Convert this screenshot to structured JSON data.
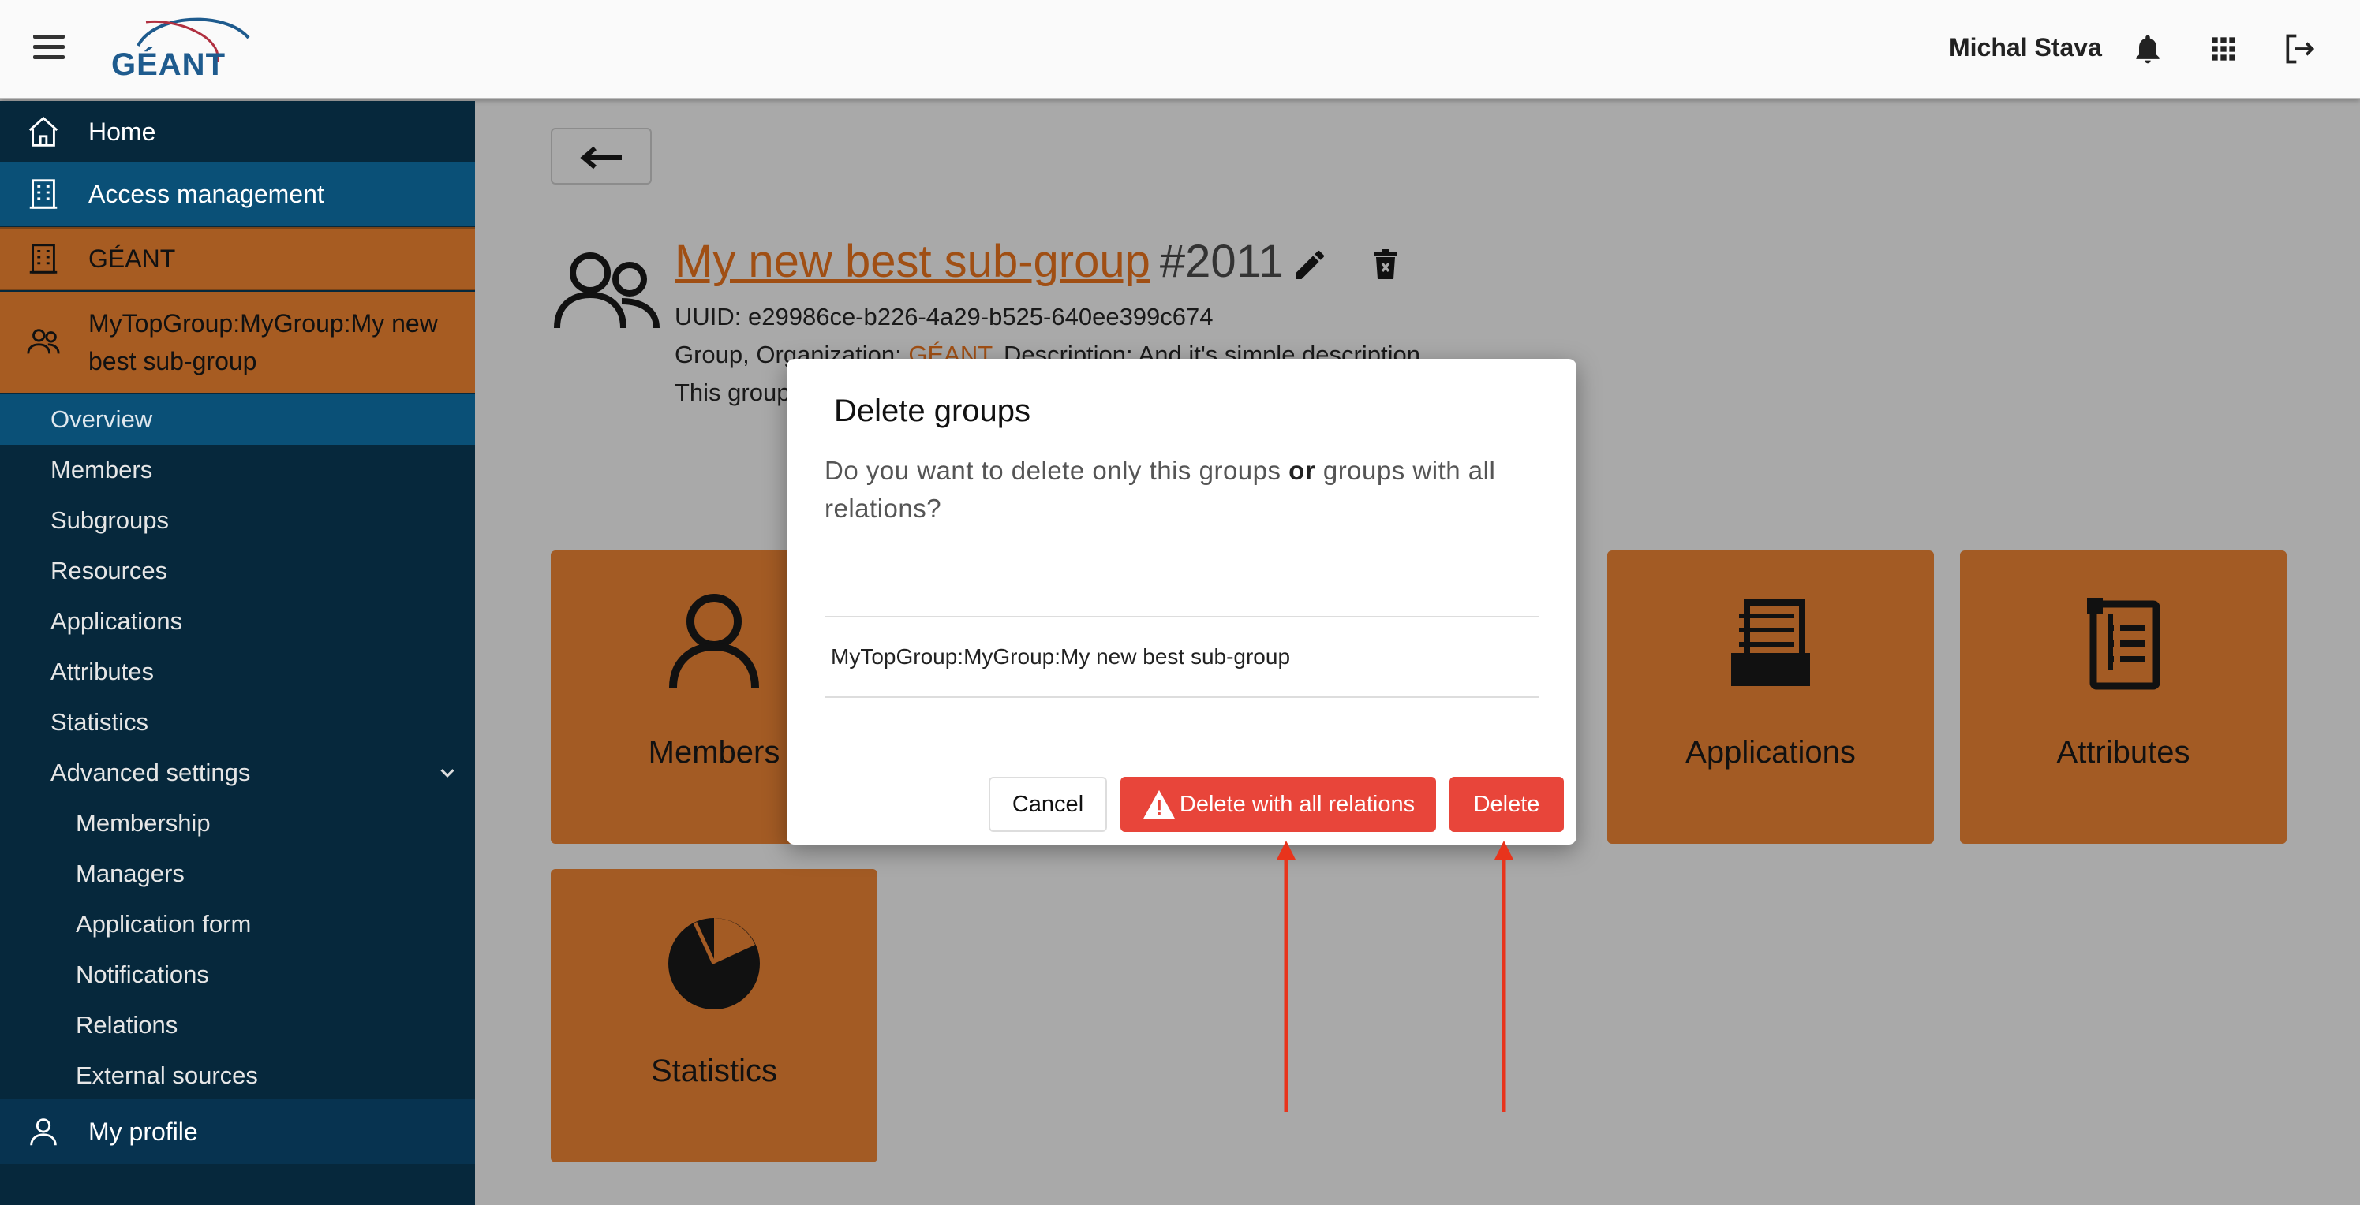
{
  "header": {
    "logo_text": "GÉANT",
    "user_name": "Michal Stava"
  },
  "sidebar": {
    "home": "Home",
    "access_management": "Access management",
    "organization": "GÉANT",
    "group": "MyTopGroup:MyGroup:My new best sub-group",
    "items": [
      "Overview",
      "Members",
      "Subgroups",
      "Resources",
      "Applications",
      "Attributes",
      "Statistics",
      "Advanced settings"
    ],
    "advanced_items": [
      "Membership",
      "Managers",
      "Application form",
      "Notifications",
      "Relations",
      "External sources"
    ],
    "my_profile": "My profile"
  },
  "group": {
    "name": "My new best sub-group",
    "id": "#2011",
    "uuid_line": "UUID: e29986ce-b226-4a29-b525-640ee399c674",
    "info_prefix": "Group, Organization: ",
    "info_org": "GÉANT",
    "info_suffix": ". Description: And it's simple description",
    "line3": "This group"
  },
  "tiles": [
    "Members",
    "Applications",
    "Attributes",
    "Statistics"
  ],
  "dialog": {
    "title": "Delete groups",
    "message_part1": "Do you want to delete only this groups ",
    "message_bold": "or",
    "message_part2": " groups with all relations?",
    "item": "MyTopGroup:MyGroup:My new best sub-group",
    "cancel": "Cancel",
    "delete_all": "Delete with all relations",
    "delete": "Delete"
  },
  "colors": {
    "accent_orange": "#a35b24",
    "sidebar_bg": "#06283c",
    "sidebar_active": "#0a5077",
    "danger": "#e8453a",
    "annotation_arrow": "#e8341c"
  }
}
